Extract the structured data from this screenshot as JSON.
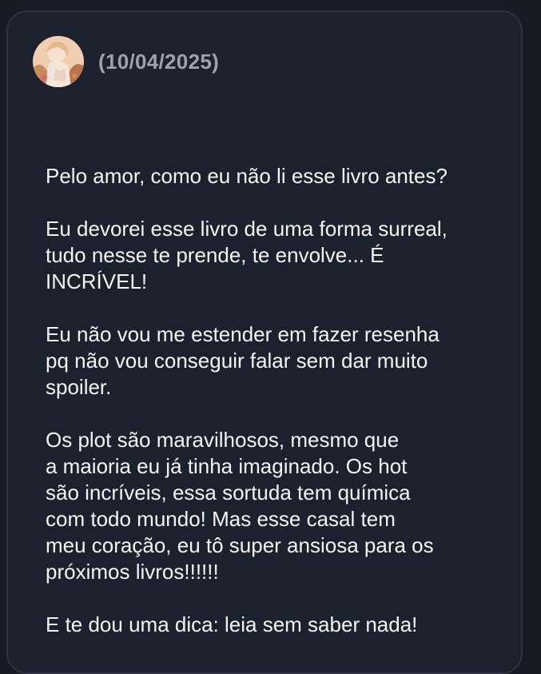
{
  "review": {
    "date": "(10/04/2025)",
    "paragraphs": [
      {
        "lines": [
          "Pelo amor, como eu não li esse livro antes?"
        ]
      },
      {
        "lines": [
          "Eu devorei esse livro de uma forma surreal,",
          "tudo nesse te prende, te envolve... É",
          "INCRÍVEL!"
        ]
      },
      {
        "lines": [
          "Eu não vou me estender em fazer resenha",
          "pq não vou conseguir falar sem dar muito",
          "spoiler."
        ]
      },
      {
        "lines": [
          "Os plot são maravilhosos, mesmo que",
          "a maioria eu já tinha imaginado. Os hot",
          "são incríveis, essa sortuda tem química",
          "com todo mundo! Mas esse casal tem",
          "meu coração, eu tô super ansiosa para os",
          "próximos livros!!!!!!"
        ]
      },
      {
        "lines": [
          "E te dou uma dica: leia sem saber nada!"
        ]
      }
    ]
  },
  "colors": {
    "background": "#161c25",
    "card": "#1b222d",
    "text": "#f2f4f6",
    "muted": "#9aa3ae"
  }
}
